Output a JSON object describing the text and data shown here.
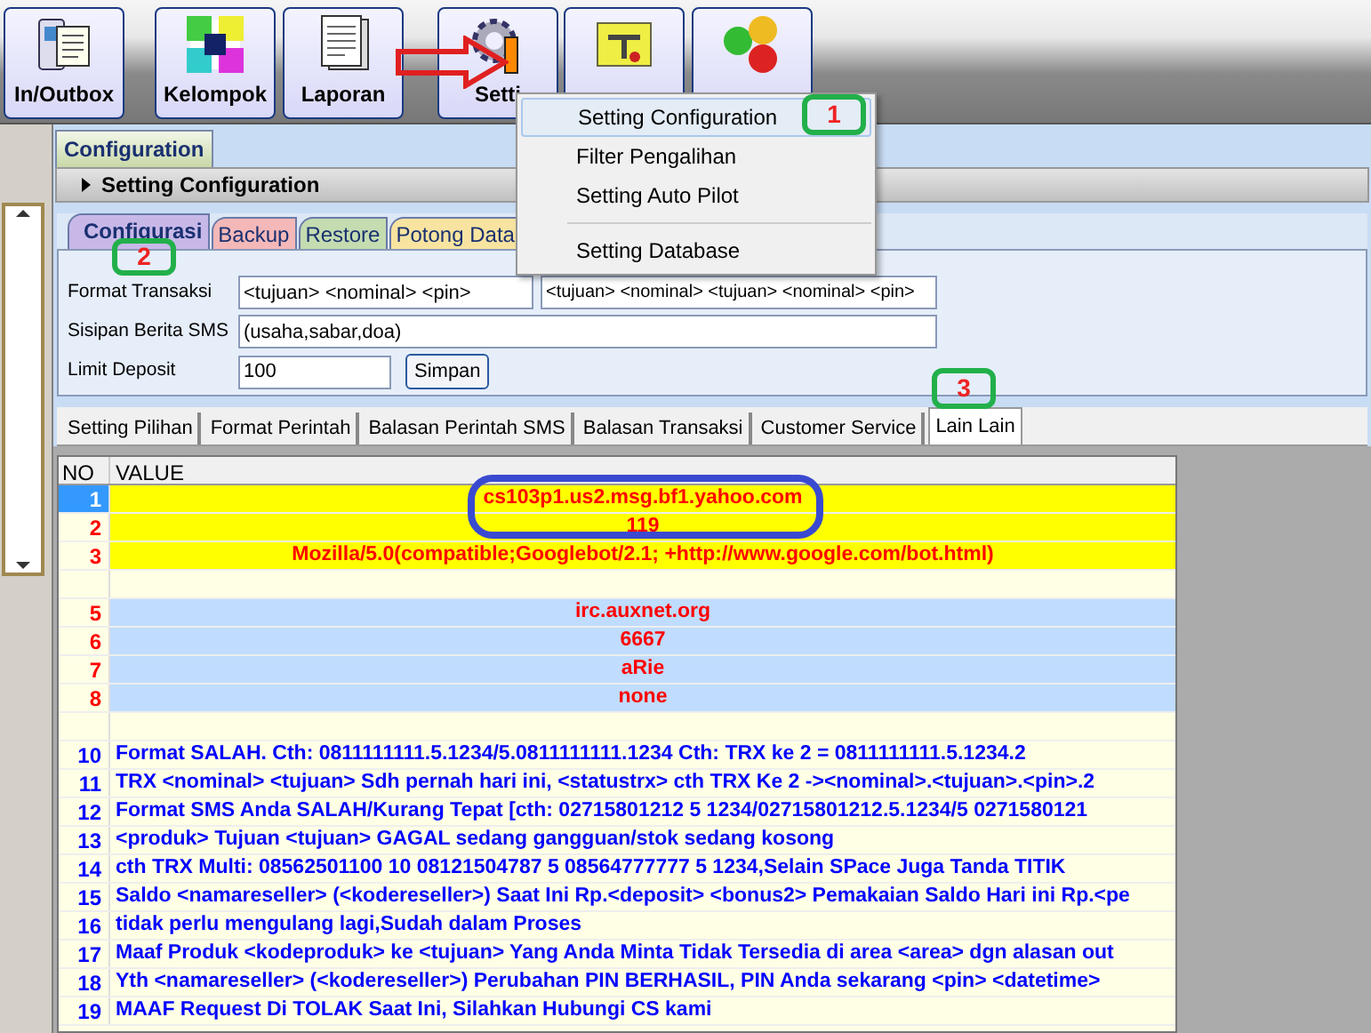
{
  "toolbar": [
    {
      "kind": "labeled",
      "label": "In/Outbox"
    },
    {
      "kind": "labeled",
      "label": "Kelompok"
    },
    {
      "kind": "labeled",
      "label": "Laporan"
    },
    {
      "kind": "labeled",
      "label": "Setti"
    },
    {
      "kind": "icon_only"
    },
    {
      "kind": "icon_only"
    }
  ],
  "menu": [
    {
      "label": "Setting Configuration",
      "selected": true
    },
    {
      "label": "Filter Pengalihan",
      "selected": false
    },
    {
      "label": "Setting Auto Pilot",
      "selected": false
    },
    {
      "kind": "separator"
    },
    {
      "label": "Setting Database",
      "selected": false
    }
  ],
  "document_tab": "Configuration",
  "panel_title": "Setting Configuration",
  "tabs": [
    {
      "label": "Configurasi",
      "selected": true,
      "color": "#c8b8e8"
    },
    {
      "label": "Backup",
      "selected": false,
      "color": "#f4b8b8"
    },
    {
      "label": "Restore",
      "selected": false,
      "color": "#c4dcb0"
    },
    {
      "label": "Potong Data",
      "selected": false,
      "color": "#f8e4a0"
    }
  ],
  "form": {
    "format_label": "Format Transaksi",
    "format_value": "<tujuan> <nominal> <pin>",
    "format_multi_value": "<tujuan> <nominal> <tujuan> <nominal> <pin>",
    "sisipan_label": "Sisipan Berita SMS",
    "sisipan_value": "(usaha,sabar,doa)",
    "limit_label": "Limit Deposit",
    "limit_value": "100",
    "save_button": "Simpan"
  },
  "sub_tabs": [
    {
      "label": "Setting Pilihan",
      "selected": false
    },
    {
      "label": "Format Perintah",
      "selected": false
    },
    {
      "label": "Balasan Perintah SMS",
      "selected": false
    },
    {
      "label": "Balasan Transaksi",
      "selected": false
    },
    {
      "label": "Customer Service",
      "selected": false
    },
    {
      "label": "Lain Lain",
      "selected": true
    }
  ],
  "table": {
    "columns": [
      "NO",
      "VALUE"
    ],
    "rows": [
      {
        "no": "1",
        "value": "cs103p1.us2.msg.bf1.yahoo.com",
        "kind": "highlight",
        "selected": true
      },
      {
        "no": "2",
        "value": "119",
        "kind": "highlight",
        "selected": false
      },
      {
        "no": "3",
        "value": "Mozilla/5.0(compatible;Googlebot/2.1; +http://www.google.com/bot.html)",
        "kind": "highlight",
        "selected": false
      },
      {
        "kind": "blank",
        "selected": false
      },
      {
        "no": "5",
        "value": "irc.auxnet.org",
        "kind": "group",
        "selected": false
      },
      {
        "no": "6",
        "value": "6667",
        "kind": "group",
        "selected": false
      },
      {
        "no": "7",
        "value": "aRie",
        "kind": "group",
        "selected": false
      },
      {
        "no": "8",
        "value": "none",
        "kind": "group",
        "selected": false
      },
      {
        "kind": "blank",
        "selected": false
      },
      {
        "no": "10",
        "value": "Format SALAH. Cth: 0811111111.5.1234/5.0811111111.1234 Cth: TRX ke 2 = 0811111111.5.1234.2",
        "kind": "message",
        "selected": false
      },
      {
        "no": "11",
        "value": "TRX <nominal> <tujuan> Sdh pernah hari ini, <statustrx> cth TRX Ke 2 -><nominal>.<tujuan>.<pin>.2",
        "kind": "message",
        "selected": false
      },
      {
        "no": "12",
        "value": "Format SMS Anda SALAH/Kurang Tepat [cth: 02715801212 5 1234/02715801212.5.1234/5 0271580121",
        "kind": "message",
        "selected": false
      },
      {
        "no": "13",
        "value": "<produk> Tujuan <tujuan> GAGAL sedang gangguan/stok sedang kosong",
        "kind": "message",
        "selected": false
      },
      {
        "no": "14",
        "value": "cth TRX Multi: 08562501100 10 08121504787 5 08564777777 5 1234,Selain SPace Juga Tanda TITIK",
        "kind": "message",
        "selected": false
      },
      {
        "no": "15",
        "value": "Saldo <namareseller> (<kodereseller>) Saat Ini Rp.<deposit> <bonus2> Pemakaian Saldo Hari ini Rp.<pe",
        "kind": "message",
        "selected": false
      },
      {
        "no": "16",
        "value": "tidak perlu mengulang lagi,Sudah dalam Proses",
        "kind": "message",
        "selected": false
      },
      {
        "no": "17",
        "value": "Maaf Produk <kodeproduk> ke <tujuan> Yang Anda Minta Tidak Tersedia di area <area> dgn alasan out",
        "kind": "message",
        "selected": false
      },
      {
        "no": "18",
        "value": "Yth <namareseller> (<kodereseller>) Perubahan PIN BERHASIL, PIN Anda sekarang <pin> <datetime>",
        "kind": "message",
        "selected": false
      },
      {
        "no": "19",
        "value": "MAAF Request Di TOLAK Saat Ini, Silahkan Hubungi CS kami",
        "kind": "message",
        "selected": false
      }
    ]
  },
  "annotations": [
    {
      "label": "1"
    },
    {
      "label": "2"
    },
    {
      "label": "3"
    }
  ]
}
